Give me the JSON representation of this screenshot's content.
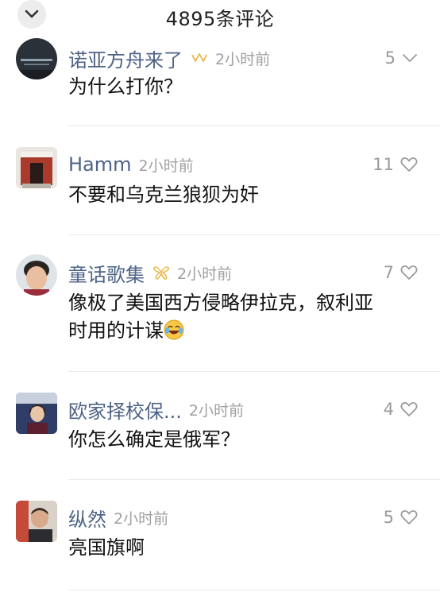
{
  "header": {
    "title": "4895条评论",
    "collapse_icon": "chevron-down-icon"
  },
  "comments": [
    {
      "username": "诺亚方舟来了",
      "badge": "crown-icon",
      "time": "2小时前",
      "likes": "5",
      "text": "为什么打你？"
    },
    {
      "username": "Hamm",
      "time": "2小时前",
      "likes": "11",
      "text": "不要和乌克兰狼狈为奸"
    },
    {
      "username": "童话歌集",
      "badge": "wings-icon",
      "time": "2小时前",
      "likes": "7",
      "text_line1": "像极了美国西方侵略伊拉克，叙利亚",
      "text_line2": "时用的计谋",
      "emoji": "laugh-cry-icon"
    },
    {
      "username": "欧家择校保...",
      "time": "2小时前",
      "likes": "4",
      "text": "你怎么确定是俄军？"
    },
    {
      "username": "纵然",
      "time": "2小时前",
      "likes": "5",
      "text": "亮国旗啊"
    }
  ],
  "colors": {
    "username": "#4e6387",
    "badge_gold": "#e8b84a",
    "meta_gray": "#a0a0a0",
    "divider": "#ebebeb"
  }
}
